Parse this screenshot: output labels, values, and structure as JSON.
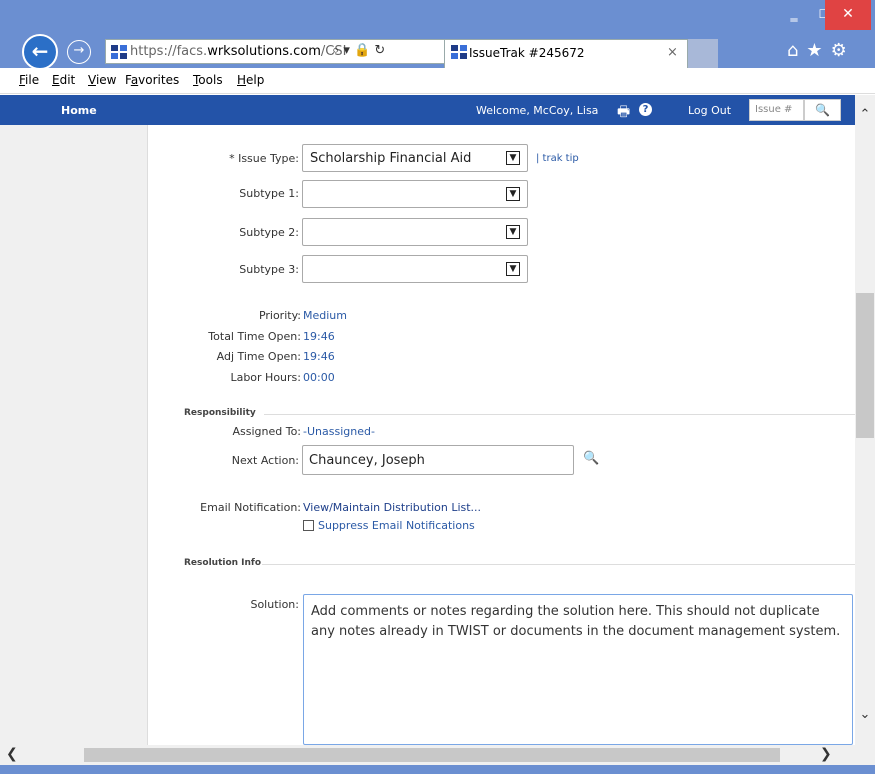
{
  "window": {
    "minimize_glyph": "‗",
    "maximize_glyph": "☐",
    "close_glyph": "✕"
  },
  "browser": {
    "address_prefix": "https://facs.",
    "address_domain": "wrksolutions.com",
    "address_suffix": "/CSI",
    "address_controls": "⌕ ▾ 🔒 ↻",
    "tab_title": "IssueTrak #245672",
    "tab_close": "×",
    "home_star_gear": "⌂★⚙",
    "back_glyph": "←",
    "forward_glyph": "→"
  },
  "menu": {
    "items": [
      {
        "pre": "",
        "u": "F",
        "post": "ile"
      },
      {
        "pre": "",
        "u": "E",
        "post": "dit"
      },
      {
        "pre": "",
        "u": "V",
        "post": "iew"
      },
      {
        "pre": "F",
        "u": "a",
        "post": "vorites"
      },
      {
        "pre": "",
        "u": "T",
        "post": "ools"
      },
      {
        "pre": "",
        "u": "H",
        "post": "elp"
      }
    ]
  },
  "nav": {
    "home": "Home",
    "welcome": "Welcome, McCoy, Lisa",
    "print_icon": "🖶",
    "help_icon": "?",
    "logout": "Log Out",
    "issue_placeholder": "Issue #",
    "search_icon": "🔍"
  },
  "form": {
    "issue_type_label": "* Issue Type:",
    "issue_type_value": "Scholarship Financial Aid",
    "trak_tip": "| trak tip",
    "subtype1_label": "Subtype 1:",
    "subtype2_label": "Subtype 2:",
    "subtype3_label": "Subtype 3:",
    "dropdown_arrow": "▼",
    "priority_label": "Priority:",
    "priority_value": "Medium",
    "total_time_label": "Total Time Open:",
    "total_time_value": "19:46",
    "adj_time_label": "Adj Time Open:",
    "adj_time_value": "19:46",
    "labor_label": "Labor Hours:",
    "labor_value": "00:00",
    "responsibility_section": "Responsibility",
    "assigned_label": "Assigned To:",
    "assigned_value": "-Unassigned-",
    "next_action_label": "Next Action:",
    "next_action_value": "Chauncey, Joseph",
    "email_label": "Email Notification:",
    "email_link": "View/Maintain Distribution List...",
    "suppress_label": "Suppress Email Notifications",
    "resolution_section": "Resolution Info",
    "solution_label": "Solution:",
    "solution_text": "Add comments or notes regarding the solution here.  This should not duplicate any notes already in TWIST or documents in the document management system."
  },
  "scroll": {
    "up": "⌃",
    "down": "⌄",
    "left": "❮",
    "right": "❯"
  }
}
